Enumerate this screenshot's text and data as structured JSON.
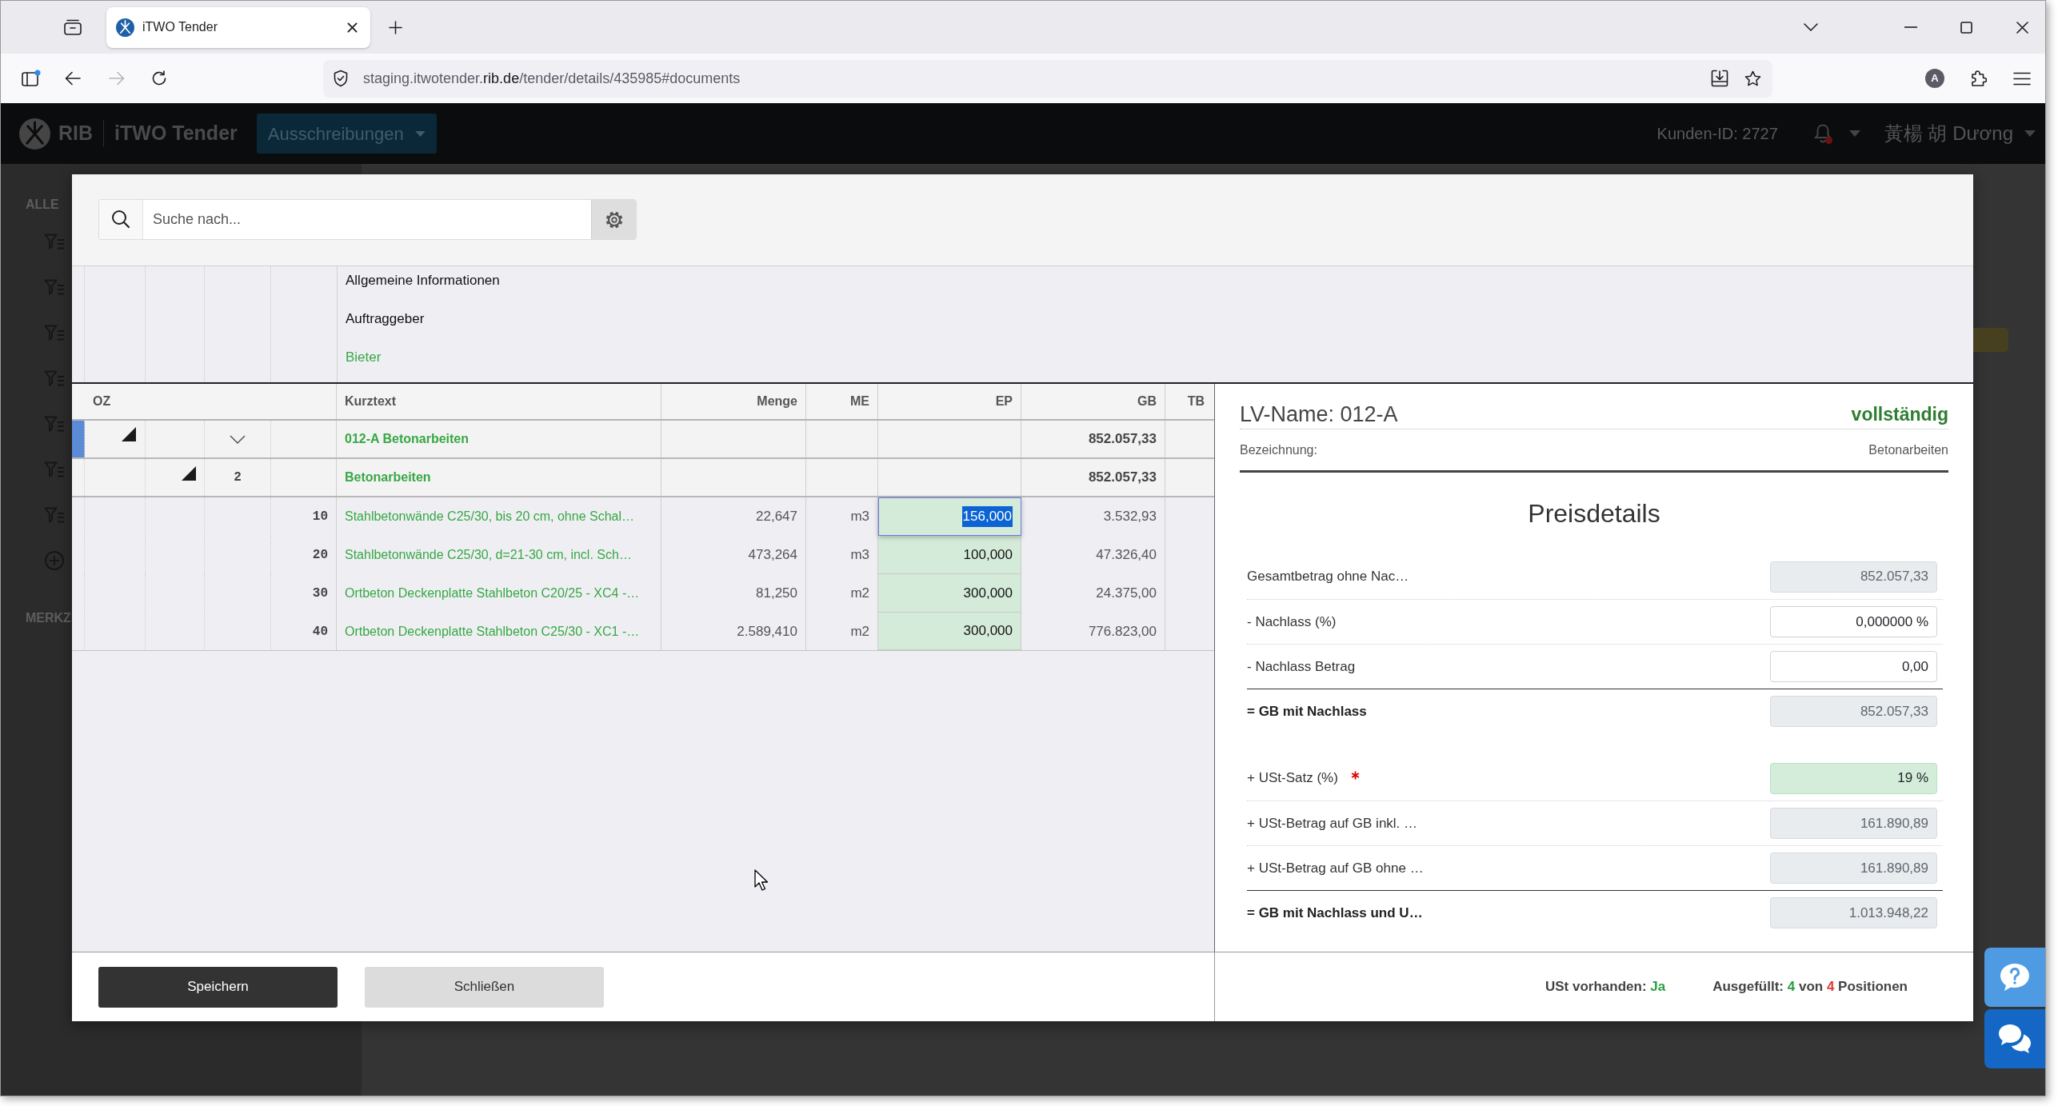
{
  "browser": {
    "tab_title": "iTWO Tender",
    "url": {
      "subdomain": "staging.itwotender.",
      "domain": "rib.de",
      "path": "/tender/details/435985#documents"
    },
    "profile_initial": "A"
  },
  "app_header": {
    "brand": "RIB",
    "product": "iTWO Tender",
    "menu": "Ausschreibungen",
    "customer_id": "Kunden-ID: 2727",
    "notifications_unread": true,
    "user_name": "黃楊 胡 Dương"
  },
  "sidebar": {
    "headings": [
      "ALLE",
      "MERKZ"
    ]
  },
  "search": {
    "placeholder": "Suche nach..."
  },
  "info_sections": [
    {
      "label": "Allgemeine Informationen",
      "selected": false
    },
    {
      "label": "Auftraggeber",
      "selected": false
    },
    {
      "label": "Bieter",
      "selected": true
    }
  ],
  "table": {
    "columns": [
      "OZ",
      "Kurztext",
      "Menge",
      "ME",
      "EP",
      "GB",
      "TB"
    ],
    "rows": [
      {
        "kind": "lv",
        "text": "012-A Betonarbeiten",
        "gb": "852.057,33",
        "expanded": true,
        "selected": true,
        "children": [
          {
            "kind": "title",
            "oz": "2",
            "text": "Betonarbeiten",
            "gb": "852.057,33",
            "expanded": true,
            "selected": false,
            "children": [
              {
                "kind": "position",
                "oz": "10",
                "text": "Stahlbetonwände C25/30, bis 20 cm, ohne Schal…",
                "menge": "22,647",
                "me": "m3",
                "ep": "156,000",
                "gb": "3.532,93",
                "editing": true,
                "selected": false
              },
              {
                "kind": "position",
                "oz": "20",
                "text": "Stahlbetonwände C25/30, d=21-30 cm, incl. Sch…",
                "menge": "473,264",
                "me": "m3",
                "ep": "100,000",
                "gb": "47.326,40",
                "editing": false,
                "selected": false
              },
              {
                "kind": "position",
                "oz": "30",
                "text": "Ortbeton Deckenplatte Stahlbeton C20/25 - XC4 -…",
                "menge": "81,250",
                "me": "m2",
                "ep": "300,000",
                "gb": "24.375,00",
                "editing": false,
                "selected": false
              },
              {
                "kind": "position",
                "oz": "40",
                "text": "Ortbeton Deckenplatte Stahlbeton C25/30 - XC1 -…",
                "menge": "2.589,410",
                "me": "m2",
                "ep": "300,000",
                "gb": "776.823,00",
                "editing": false,
                "selected": false
              }
            ]
          }
        ]
      }
    ]
  },
  "summary": {
    "lv_name": "LV-Name: 012-A",
    "status": "vollständig",
    "designation_label": "Bezeichnung:",
    "designation": "Betonarbeiten"
  },
  "price_details": {
    "title": "Preisdetails",
    "rows": [
      {
        "label": "Gesamtbetrag ohne Nac…",
        "value": "852.057,33",
        "kind": "readonly",
        "total": false,
        "required": false
      },
      {
        "label": "- Nachlass (%)",
        "value": "0,000000 %",
        "kind": "input",
        "total": false,
        "required": false
      },
      {
        "label": "- Nachlass Betrag",
        "value": "0,00",
        "kind": "input",
        "total": false,
        "required": false
      },
      {
        "label": "= GB mit Nachlass",
        "value": "852.057,33",
        "kind": "readonly",
        "total": true,
        "required": false
      },
      {
        "label": "+ USt-Satz (%)",
        "value": "19 %",
        "kind": "valid",
        "total": false,
        "required": true
      },
      {
        "label": "+ USt-Betrag auf GB inkl. …",
        "value": "161.890,89",
        "kind": "readonly",
        "total": false,
        "required": false
      },
      {
        "label": "+ USt-Betrag auf GB ohne …",
        "value": "161.890,89",
        "kind": "readonly",
        "total": false,
        "required": false
      },
      {
        "label": "= GB mit Nachlass und U…",
        "value": "1.013.948,22",
        "kind": "readonly",
        "total": true,
        "required": false
      }
    ]
  },
  "footer": {
    "buttons": [
      {
        "label": "Speichern",
        "kind": "primary"
      },
      {
        "label": "Schließen",
        "kind": "secondary"
      }
    ],
    "vat": {
      "label": "USt vorhanden:",
      "value": "Ja"
    },
    "progress": {
      "label": "Ausgefüllt:",
      "filled": "4",
      "of": "von",
      "total": "4",
      "unit": "Positionen"
    }
  }
}
